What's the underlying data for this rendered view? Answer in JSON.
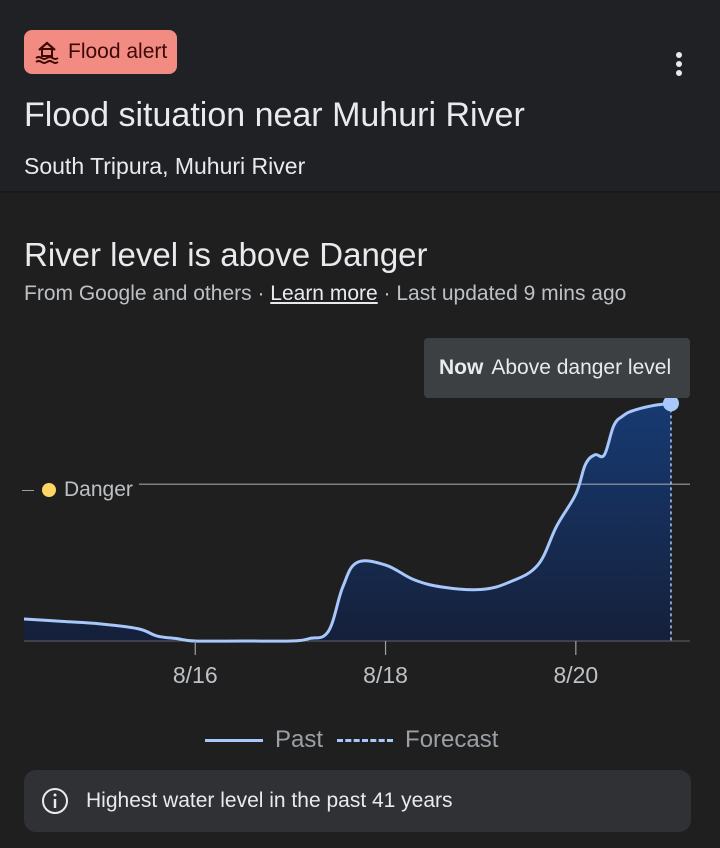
{
  "header": {
    "alert_label": "Flood alert",
    "title": "Flood situation near Muhuri River",
    "subtitle": "South Tripura, Muhuri River"
  },
  "status": {
    "headline": "River level is above Danger",
    "source_prefix": "From Google and others · ",
    "learn_more": "Learn more",
    "updated": " · Last updated 9 mins ago"
  },
  "tooltip": {
    "now": "Now",
    "text": "Above danger level"
  },
  "danger_label": "Danger",
  "legend": {
    "past": "Past",
    "forecast": "Forecast"
  },
  "info": {
    "text": "Highest water level in the past 41 years"
  },
  "colors": {
    "alert_bg": "#f28b82",
    "line": "#a8c7fa",
    "danger": "#fdd663",
    "fill": "#173361"
  },
  "chart_data": {
    "type": "area",
    "x_unit": "day (August)",
    "tick_labels": [
      "8/16",
      "8/18",
      "8/20"
    ],
    "tick_positions": [
      16,
      18,
      20
    ],
    "xlim": [
      14.2,
      21.2
    ],
    "ylim": [
      0,
      1
    ],
    "danger_level": 0.64,
    "now_x": 21.0,
    "series": [
      {
        "name": "Past",
        "x": [
          14.2,
          14.6,
          15.0,
          15.4,
          15.6,
          15.8,
          16.0,
          16.5,
          17.0,
          17.2,
          17.4,
          17.55,
          17.7,
          18.0,
          18.3,
          18.6,
          19.0,
          19.3,
          19.6,
          19.8,
          20.0,
          20.1,
          20.2,
          20.3,
          20.4,
          20.5,
          20.6,
          20.8,
          21.0
        ],
        "y": [
          0.09,
          0.08,
          0.07,
          0.05,
          0.02,
          0.01,
          0.0,
          0.0,
          0.0,
          0.01,
          0.04,
          0.22,
          0.32,
          0.31,
          0.25,
          0.22,
          0.21,
          0.24,
          0.31,
          0.47,
          0.6,
          0.72,
          0.76,
          0.76,
          0.88,
          0.92,
          0.94,
          0.96,
          0.97
        ]
      }
    ]
  }
}
